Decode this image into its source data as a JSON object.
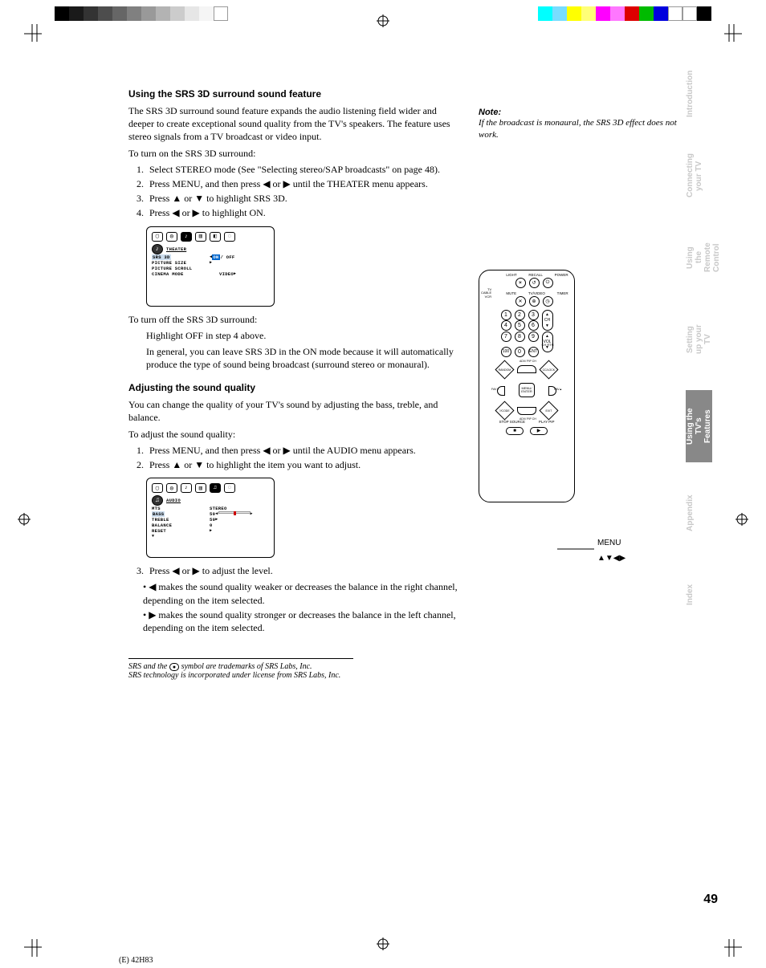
{
  "page_number": "49",
  "model": "(E) 42H83",
  "tabs": [
    "Introduction",
    "Connecting your TV",
    "Using the Remote Control",
    "Setting up your TV",
    "Using the TV's Features",
    "Appendix",
    "Index"
  ],
  "active_tab_index": 4,
  "section1": {
    "heading": "Using the SRS 3D surround sound feature",
    "p1": "The SRS 3D surround sound feature expands the audio listening field wider and deeper to create exceptional sound quality from the TV's speakers. The feature uses stereo signals from a TV broadcast or video input.",
    "p2": "To turn on the SRS 3D surround:",
    "steps": [
      "Select STEREO mode (See \"Selecting stereo/SAP broadcasts\" on page 48).",
      "Press MENU, and then press ◀ or ▶ until the THEATER menu appears.",
      "Press ▲ or ▼ to highlight SRS 3D.",
      "Press ◀ or ▶ to highlight ON."
    ],
    "p3": "To turn off the SRS 3D surround:",
    "p4": "Highlight OFF in step 4 above.",
    "p5": "In general, you can leave SRS 3D in the ON mode because it will automatically produce the type of sound being broadcast (surround stereo or monaural)."
  },
  "section2": {
    "heading": "Adjusting the sound quality",
    "p1": "You can change the quality of your TV's sound by adjusting the bass, treble, and balance.",
    "p2": "To adjust the sound quality:",
    "steps": [
      "Press MENU, and then press ◀ or ▶ until the AUDIO menu appears.",
      "Press ▲ or ▼ to highlight the item you want to adjust."
    ],
    "p3": "Press ◀ or ▶ to adjust the level.",
    "bullets": [
      "◀ makes the sound quality weaker or decreases the balance in the right channel, depending on the item selected.",
      "▶ makes the sound quality stronger or decreases the balance in the left channel, depending on the item selected."
    ]
  },
  "note": {
    "heading": "Note:",
    "text": "If the broadcast is monaural, the SRS 3D effect does not work."
  },
  "osd1": {
    "title": "THEATER",
    "rows": [
      {
        "label": "SRS 3D",
        "value": "ON",
        "alt": "/ OFF"
      },
      {
        "label": "PICTURE SIZE",
        "value": ""
      },
      {
        "label": "PICTURE SCROLL",
        "value": ""
      },
      {
        "label": "CINEMA MODE",
        "value": "VIDEO"
      }
    ]
  },
  "osd2": {
    "title": "AUDIO",
    "rows": [
      {
        "label": "MTS",
        "value": "STEREO"
      },
      {
        "label": "BASS",
        "value": "50"
      },
      {
        "label": "TREBLE",
        "value": "50"
      },
      {
        "label": "BALANCE",
        "value": "0"
      },
      {
        "label": "RESET",
        "value": ""
      }
    ]
  },
  "remote": {
    "top_labels": [
      "LIGHT",
      "RECALL",
      "POWER"
    ],
    "mid_labels": [
      "MUTE",
      "TV/VIDEO",
      "TIMER"
    ],
    "selector": [
      "TV",
      "CABLE",
      "VCR"
    ],
    "numbers": [
      "1",
      "2",
      "3",
      "4",
      "5",
      "6",
      "7",
      "8",
      "9",
      "100",
      "0",
      "ENT"
    ],
    "ch": "CH",
    "vol": "VOL",
    "chrtn": "CH RTN",
    "dpad": {
      "center": "MENU/\nENTER",
      "tl": "RANDOM",
      "tr": "CC/LOCK",
      "bl": "?/CODE",
      "br": "EXIT",
      "fav": "FAV",
      "top": "ADV/\nPIP CH",
      "bottom": "ADV/\nPIP CH"
    },
    "pip": [
      "STOP SOURCE",
      "PLAY PIP"
    ],
    "label1": "MENU",
    "label2": "▲▼◀▶"
  },
  "footnotes": [
    "SRS and the ● symbol are trademarks of SRS Labs, Inc.",
    "SRS technology is incorporated under license from SRS Labs, Inc."
  ]
}
